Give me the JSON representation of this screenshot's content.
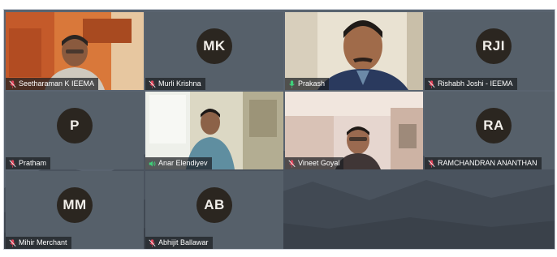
{
  "colors": {
    "tile_background": "#4f5a63",
    "avatar_background": "#2b2620",
    "name_tag_background": "#1c1e22",
    "muted_mic": "#e0445a",
    "active_mic": "#3fd17a"
  },
  "participants": [
    {
      "name": "Seetharaman K IEEMA",
      "initials": "",
      "video": true,
      "mic": "muted"
    },
    {
      "name": "Murli Krishna",
      "initials": "MK",
      "video": false,
      "mic": "muted"
    },
    {
      "name": "Prakash",
      "initials": "",
      "video": true,
      "mic": "active"
    },
    {
      "name": "Rishabh Joshi - IEEMA",
      "initials": "RJI",
      "video": false,
      "mic": "muted"
    },
    {
      "name": "Pratham",
      "initials": "P",
      "video": false,
      "mic": "muted"
    },
    {
      "name": "Anar Elendiyev",
      "initials": "",
      "video": true,
      "mic": "active"
    },
    {
      "name": "Vineet Goyal",
      "initials": "",
      "video": true,
      "mic": "muted"
    },
    {
      "name": "RAMCHANDRAN ANANTHAN",
      "initials": "RA",
      "video": false,
      "mic": "muted"
    },
    {
      "name": "Mihir Merchant",
      "initials": "MM",
      "video": false,
      "mic": "muted"
    },
    {
      "name": "Abhijit Ballawar",
      "initials": "AB",
      "video": false,
      "mic": "muted"
    }
  ]
}
